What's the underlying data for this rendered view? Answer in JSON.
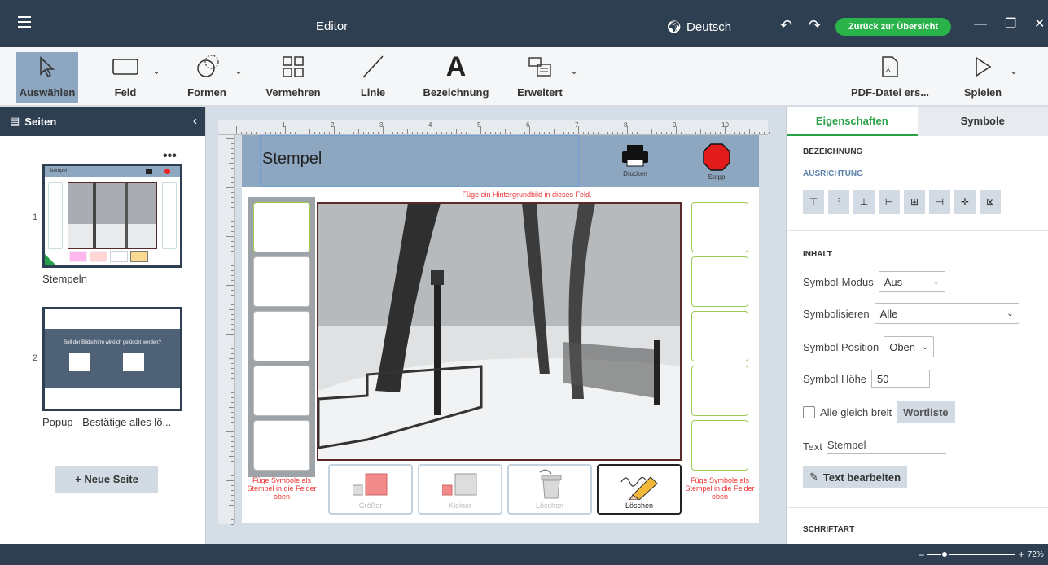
{
  "titlebar": {
    "title": "Editor",
    "language": "Deutsch",
    "back_label": "Zurück zur Übersicht"
  },
  "toolbar": {
    "select_label": "Auswählen",
    "field_label": "Feld",
    "shapes_label": "Formen",
    "multiply_label": "Vermehren",
    "line_label": "Linie",
    "caption_label": "Bezeichnung",
    "extended_label": "Erweitert",
    "pdf_label": "PDF-Datei ers...",
    "play_label": "Spielen"
  },
  "pages_panel": {
    "title": "Seiten",
    "pages": [
      {
        "number": "1",
        "name": "Stempeln",
        "thumb_title": "Stempel"
      },
      {
        "number": "2",
        "name": "Popup - Bestätige alles lö...",
        "thumb_question": "Soll der Bildschirm wirklich gelöscht werden?"
      }
    ],
    "new_page_label": "+ Neue Seite"
  },
  "canvas": {
    "ruler_numbers": [
      "1",
      "2",
      "3",
      "4",
      "5",
      "6",
      "7",
      "8",
      "9",
      "10"
    ],
    "page_title": "Stempel",
    "print_label": "Drucken",
    "stop_label": "Stopp",
    "background_hint": "Füge ein Hintergrundbild in dieses Feld.",
    "stamp_hint": "Füge Symbole als Stempel in die Felder oben",
    "buttons": [
      {
        "label": "Größer"
      },
      {
        "label": "Kleiner"
      },
      {
        "label": "Löschen"
      },
      {
        "label": "Löschen"
      }
    ]
  },
  "properties": {
    "tab_properties": "Eigenschaften",
    "tab_symbols": "Symbole",
    "section_caption": "BEZEICHNUNG",
    "section_alignment": "AUSRICHTUNG",
    "section_content": "INHALT",
    "symbol_mode_label": "Symbol-Modus",
    "symbol_mode_value": "Aus",
    "symbolize_label": "Symbolisieren",
    "symbolize_value": "Alle",
    "symbol_position_label": "Symbol Position",
    "symbol_position_value": "Oben",
    "symbol_height_label": "Symbol Höhe",
    "symbol_height_value": "50",
    "equal_width_label": "Alle gleich breit",
    "wordlist_label": "Wortliste",
    "text_label": "Text",
    "text_value": "Stempel",
    "edit_text_label": "Text bearbeiten",
    "section_font": "SCHRIFTART"
  },
  "statusbar": {
    "zoom_value": "72%",
    "zoom_level": 0.2
  }
}
